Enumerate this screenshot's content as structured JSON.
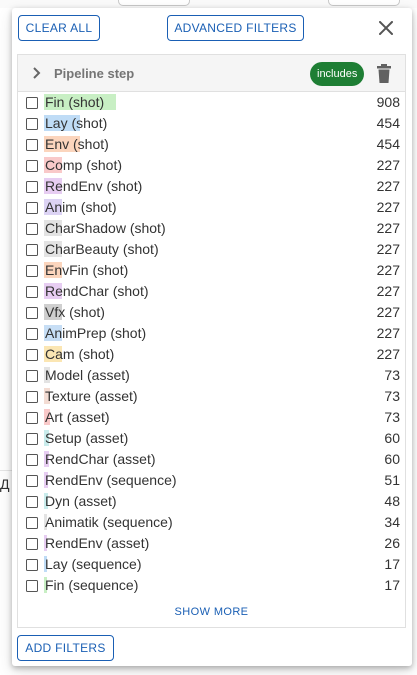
{
  "toolbar": {
    "clear_all_label": "CLEAR ALL",
    "advanced_filters_label": "ADVANCED FILTERS",
    "close_icon": "close-icon"
  },
  "filter": {
    "title": "Pipeline step",
    "mode_chip": "includes",
    "expand_icon": "chevron-right-icon",
    "delete_icon": "trash-icon",
    "items": [
      {
        "label": "Fin (shot)",
        "count": "908",
        "highlight_color": "#c8efc4",
        "highlight_fraction": 1.0
      },
      {
        "label": "Lay (shot)",
        "count": "454",
        "highlight_color": "#bfdcf6",
        "highlight_fraction": 0.5
      },
      {
        "label": "Env (shot)",
        "count": "454",
        "highlight_color": "#fbd5bd",
        "highlight_fraction": 0.5
      },
      {
        "label": "Comp (shot)",
        "count": "227",
        "highlight_color": "#f9c9c9",
        "highlight_fraction": 0.25
      },
      {
        "label": "RendEnv (shot)",
        "count": "227",
        "highlight_color": "#e7cdf2",
        "highlight_fraction": 0.25
      },
      {
        "label": "Anim (shot)",
        "count": "227",
        "highlight_color": "#dcd3f4",
        "highlight_fraction": 0.25
      },
      {
        "label": "CharShadow (shot)",
        "count": "227",
        "highlight_color": "#e3e3e3",
        "highlight_fraction": 0.25
      },
      {
        "label": "CharBeauty (shot)",
        "count": "227",
        "highlight_color": "#e3e3e3",
        "highlight_fraction": 0.25
      },
      {
        "label": "EnvFin (shot)",
        "count": "227",
        "highlight_color": "#fbd5bd",
        "highlight_fraction": 0.25
      },
      {
        "label": "RendChar (shot)",
        "count": "227",
        "highlight_color": "#e7cdf2",
        "highlight_fraction": 0.25
      },
      {
        "label": "Vfx (shot)",
        "count": "227",
        "highlight_color": "#cfcfcf",
        "highlight_fraction": 0.25
      },
      {
        "label": "AnimPrep (shot)",
        "count": "227",
        "highlight_color": "#c7def5",
        "highlight_fraction": 0.25
      },
      {
        "label": "Cam (shot)",
        "count": "227",
        "highlight_color": "#fbe6b3",
        "highlight_fraction": 0.25
      },
      {
        "label": "Model (asset)",
        "count": "73",
        "highlight_color": "#e3e3e3",
        "highlight_fraction": 0.08
      },
      {
        "label": "Texture (asset)",
        "count": "73",
        "highlight_color": "#f3dcd3",
        "highlight_fraction": 0.08
      },
      {
        "label": "Art (asset)",
        "count": "73",
        "highlight_color": "#f9c9c9",
        "highlight_fraction": 0.08
      },
      {
        "label": "Setup (asset)",
        "count": "60",
        "highlight_color": "#c9ecec",
        "highlight_fraction": 0.066
      },
      {
        "label": "RendChar (asset)",
        "count": "60",
        "highlight_color": "#e7cdf2",
        "highlight_fraction": 0.066
      },
      {
        "label": "RendEnv (sequence)",
        "count": "51",
        "highlight_color": "#e7cdf2",
        "highlight_fraction": 0.056
      },
      {
        "label": "Dyn (asset)",
        "count": "48",
        "highlight_color": "#c9ecec",
        "highlight_fraction": 0.053
      },
      {
        "label": "Animatik (sequence)",
        "count": "34",
        "highlight_color": "#e3e3e3",
        "highlight_fraction": 0.037
      },
      {
        "label": "RendEnv (asset)",
        "count": "26",
        "highlight_color": "#e7cdf2",
        "highlight_fraction": 0.029
      },
      {
        "label": "Lay (sequence)",
        "count": "17",
        "highlight_color": "#bfdcf6",
        "highlight_fraction": 0.019
      },
      {
        "label": "Fin (sequence)",
        "count": "17",
        "highlight_color": "#c8efc4",
        "highlight_fraction": 0.019
      }
    ],
    "show_more_label": "SHOW MORE"
  },
  "footer": {
    "add_filters_label": "ADD FILTERS"
  },
  "background": {
    "partial_text": "Д"
  }
}
